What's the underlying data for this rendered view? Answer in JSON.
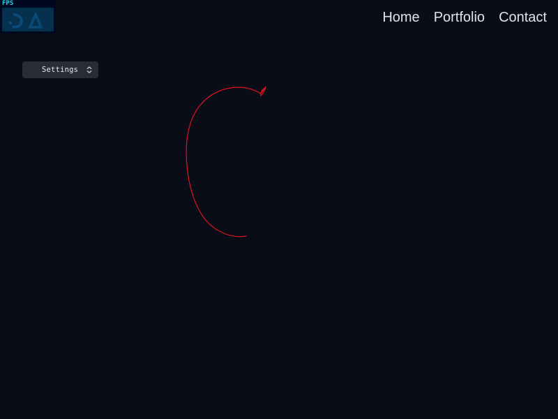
{
  "stats": {
    "label": "FPS"
  },
  "nav": {
    "items": [
      {
        "label": "Home"
      },
      {
        "label": "Portfolio"
      },
      {
        "label": "Contact"
      }
    ]
  },
  "settings": {
    "label": "Settings",
    "icon": "expand-collapse-icon"
  },
  "colors": {
    "background": "#0a0d18",
    "stroke": "#e0141e",
    "fps_text": "#17d9f0",
    "fps_bg": "#000820",
    "fps_graph": "#05314f"
  }
}
